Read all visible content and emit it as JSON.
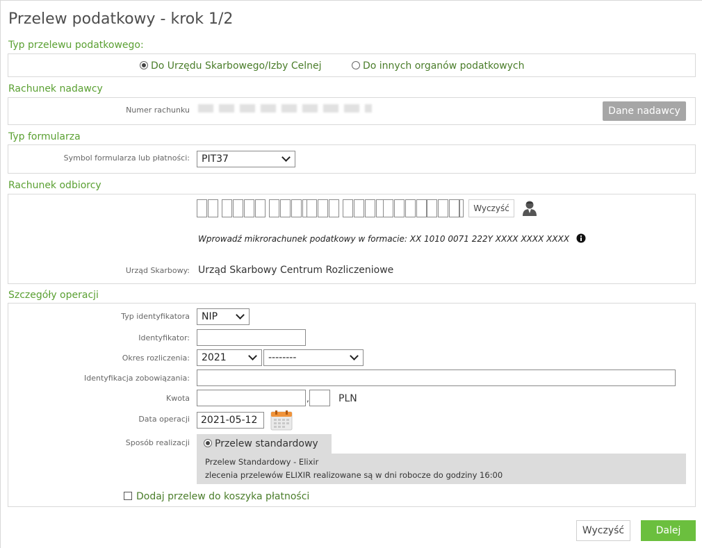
{
  "title": "Przelew podatkowy - krok 1/2",
  "sections": {
    "typ_przelewu": "Typ przelewu podatkowego:",
    "rachunek_nadawcy": "Rachunek nadawcy",
    "typ_formularza": "Typ formularza",
    "rachunek_odbiorcy": "Rachunek odbiorcy",
    "szczegoly": "Szczegóły operacji"
  },
  "transfer_type": {
    "options": [
      "Do Urzędu Skarbowego/Izby Celnej",
      "Do innych organów podatkowych"
    ],
    "selected": 0
  },
  "sender": {
    "account_label": "Numer rachunku",
    "sender_data_button": "Dane nadawcy"
  },
  "form": {
    "symbol_label": "Symbol formularza lub płatności:",
    "symbol_value": "PIT37"
  },
  "recipient": {
    "clear_button": "Wyczyść",
    "hint": "Wprowadź mikrorachunek podatkowy w formacie: XX 1010 0071 222Y XXXX XXXX XXXX",
    "office_label": "Urząd Skarbowy:",
    "office_value": "Urząd Skarbowy Centrum Rozliczeniowe"
  },
  "details": {
    "id_type_label": "Typ identyfikatora",
    "id_type_value": "NIP",
    "identifier_label": "Identyfikator:",
    "period_label": "Okres rozliczenia:",
    "period_year": "2021",
    "period_sub": "--------",
    "obligation_label": "Identyfikacja zobowiązania:",
    "amount_label": "Kwota",
    "currency": "PLN",
    "date_label": "Data operacji",
    "date_value": "2021-05-12",
    "method_label": "Sposób realizacji",
    "method_option": "Przelew standardowy",
    "method_desc_1": "Przelew Standardowy - Elixir",
    "method_desc_2": "zlecenia przelewów ELIXIR realizowane są w dni robocze do godziny 16:00",
    "basket_label": "Dodaj przelew do koszyka płatności"
  },
  "footer": {
    "clear_button": "Wyczyść",
    "next_button": "Dalej"
  },
  "colors": {
    "accent_green": "#5aa032",
    "button_green": "#6bbf3e",
    "button_grey": "#a6a6a6"
  }
}
